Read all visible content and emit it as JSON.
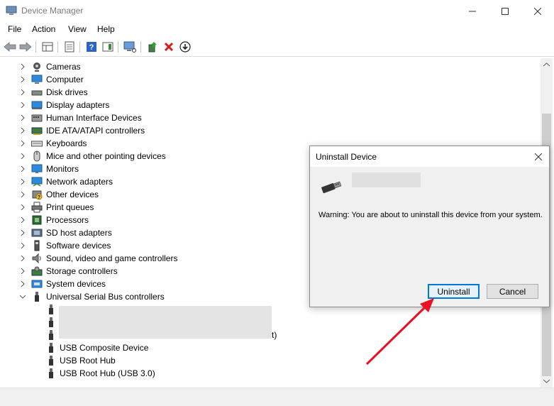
{
  "window": {
    "title": "Device Manager"
  },
  "menu": [
    "File",
    "Action",
    "View",
    "Help"
  ],
  "tree": {
    "categories": [
      {
        "label": "Cameras",
        "icon": "camera-icon"
      },
      {
        "label": "Computer",
        "icon": "computer-icon"
      },
      {
        "label": "Disk drives",
        "icon": "disk-drive-icon"
      },
      {
        "label": "Display adapters",
        "icon": "display-adapter-icon"
      },
      {
        "label": "Human Interface Devices",
        "icon": "hid-icon"
      },
      {
        "label": "IDE ATA/ATAPI controllers",
        "icon": "ide-controller-icon"
      },
      {
        "label": "Keyboards",
        "icon": "keyboard-icon"
      },
      {
        "label": "Mice and other pointing devices",
        "icon": "mouse-icon"
      },
      {
        "label": "Monitors",
        "icon": "monitor-icon"
      },
      {
        "label": "Network adapters",
        "icon": "network-adapter-icon"
      },
      {
        "label": "Other devices",
        "icon": "other-devices-icon"
      },
      {
        "label": "Print queues",
        "icon": "printer-icon"
      },
      {
        "label": "Processors",
        "icon": "processor-icon"
      },
      {
        "label": "SD host adapters",
        "icon": "sd-host-icon"
      },
      {
        "label": "Software devices",
        "icon": "software-device-icon"
      },
      {
        "label": "Sound, video and game controllers",
        "icon": "sound-icon"
      },
      {
        "label": "Storage controllers",
        "icon": "storage-controller-icon"
      },
      {
        "label": "System devices",
        "icon": "system-devices-icon"
      },
      {
        "label": "Universal Serial Bus controllers",
        "icon": "usb-controller-icon"
      }
    ],
    "usb_children": [
      "USB Composite Device",
      "USB Root Hub",
      "USB Root Hub (USB 3.0)"
    ],
    "hidden_trailing_text": "t)"
  },
  "dialog": {
    "title": "Uninstall Device",
    "warning": "Warning: You are about to uninstall this device from your system.",
    "uninstall_label": "Uninstall",
    "cancel_label": "Cancel"
  },
  "colors": {
    "accent": "#0078d7",
    "arrow": "#e81123"
  }
}
